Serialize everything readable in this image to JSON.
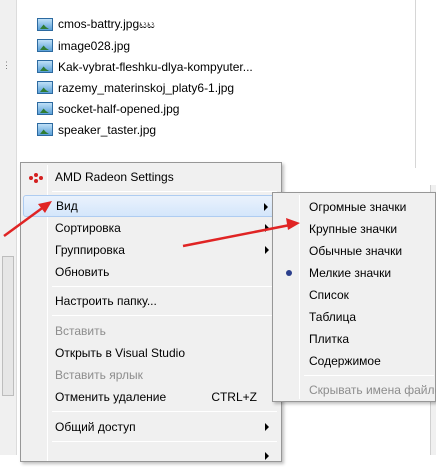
{
  "files": [
    {
      "name": "cmos-battry.jpgಟಟ",
      "icon": "image-file-icon"
    },
    {
      "name": "image028.jpg",
      "icon": "image-file-icon"
    },
    {
      "name": "Kak-vybrat-fleshku-dlya-kompyuter...",
      "icon": "image-file-icon"
    },
    {
      "name": "razemy_materinskoj_platy6-1.jpg",
      "icon": "image-file-icon"
    },
    {
      "name": "socket-half-opened.jpg",
      "icon": "image-file-icon"
    },
    {
      "name": "speaker_taster.jpg",
      "icon": "image-file-icon"
    }
  ],
  "context_menu": {
    "amd": "AMD Radeon Settings",
    "view": "Вид",
    "sort": "Сортировка",
    "group": "Группировка",
    "refresh": "Обновить",
    "customize": "Настроить папку...",
    "paste": "Вставить",
    "open_vs": "Открыть в Visual Studio",
    "paste_shortcut": "Вставить ярлык",
    "undo_delete": "Отменить удаление",
    "undo_shortcut": "CTRL+Z",
    "share": "Общий доступ"
  },
  "view_submenu": {
    "huge": "Огромные значки",
    "large": "Крупные значки",
    "normal": "Обычные значки",
    "small": "Мелкие значки",
    "list": "Список",
    "table": "Таблица",
    "tile": "Плитка",
    "content": "Содержимое",
    "hide_names": "Скрывать имена файлов"
  },
  "selected_view": "small",
  "colors": {
    "menu_bg": "#f0f0f0",
    "hover_bg": "#d4e6fb",
    "arrow_red": "#e02424",
    "amd_red": "#d42020",
    "radio_blue": "#2b3f8c"
  }
}
